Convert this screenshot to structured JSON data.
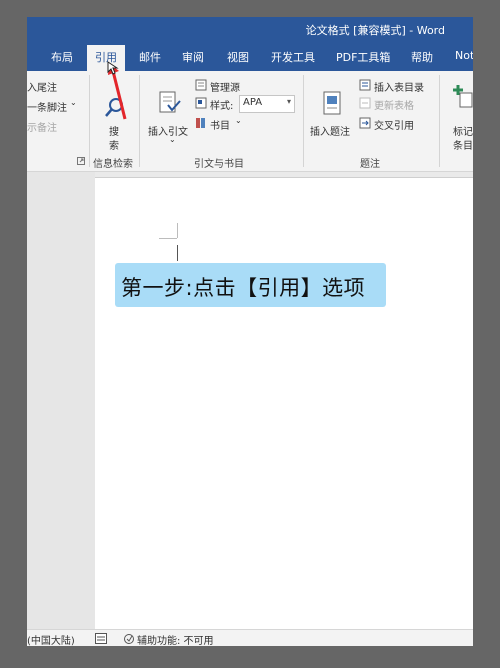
{
  "window": {
    "title": "论文格式 [兼容模式]  -  Word"
  },
  "tabs": [
    {
      "label": "布局"
    },
    {
      "label": "引用"
    },
    {
      "label": "邮件"
    },
    {
      "label": "审阅"
    },
    {
      "label": "视图"
    },
    {
      "label": "开发工具"
    },
    {
      "label": "PDF工具箱"
    },
    {
      "label": "帮助"
    },
    {
      "label": "Not"
    }
  ],
  "ribbon": {
    "footnotes": {
      "insert_endnote": "入尾注",
      "next_footnote": "一条脚注",
      "show_notes": "示备注"
    },
    "research": {
      "search_line1": "搜",
      "search_line2": "索",
      "group": "信息检索"
    },
    "citations": {
      "insert_citation": "插入引文",
      "manage_sources": "管理源",
      "style_label": "样式:",
      "style_value": "APA",
      "bibliography": "书目",
      "group": "引文与书目"
    },
    "captions": {
      "insert_caption": "插入题注",
      "insert_tof": "插入表目录",
      "update_table": "更新表格",
      "cross_reference": "交叉引用",
      "group": "题注"
    },
    "index": {
      "mark_entry_line1": "标记",
      "mark_entry_line2": "条目"
    }
  },
  "document": {
    "callout": "第一步:点击【引用】选项"
  },
  "statusbar": {
    "language": "(中国大陆)",
    "accessibility": "辅助功能: 不可用"
  },
  "colors": {
    "ribbon_blue": "#2b579a",
    "callout_bg": "#a9dcf7",
    "arrow_red": "#e3262b"
  }
}
